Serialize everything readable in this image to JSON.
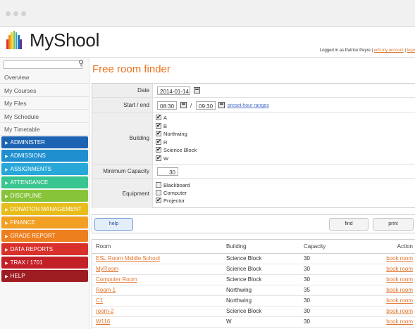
{
  "app": {
    "name": "MyShool",
    "login_prefix": "Logged in as Patrice Peyre |",
    "edit_account": "edit my account",
    "separator": "|",
    "logout": "logo"
  },
  "colors": {
    "accent": "#e8731f",
    "logo_bars": [
      "#e3342f",
      "#f28c28",
      "#f5d019",
      "#7cc242",
      "#2aa7c9",
      "#1e73be",
      "#6a2c91"
    ]
  },
  "sidebar": {
    "search_placeholder": "",
    "search_icon": "magnifier-icon",
    "plain_items": [
      "Overview",
      "My Courses",
      "My Files",
      "My Schedule",
      "My Timetable"
    ],
    "color_items": [
      {
        "label": "ADMINISTER",
        "color": "#1c64b3"
      },
      {
        "label": "ADMISSIONS",
        "color": "#1f8fd0"
      },
      {
        "label": "ASSIGNMENTS",
        "color": "#27a8d9"
      },
      {
        "label": "ATTENDANCE",
        "color": "#39c58f"
      },
      {
        "label": "DISCIPLINE",
        "color": "#88c43a"
      },
      {
        "label": "DONATION MANAGEMENT",
        "color": "#e8bd1b"
      },
      {
        "label": "FINANCE",
        "color": "#f1a023"
      },
      {
        "label": "GRADE REPORT",
        "color": "#ee7f1f"
      },
      {
        "label": "DATA REPORTS",
        "color": "#d9302b"
      },
      {
        "label": "TRAX / 1701",
        "color": "#c22026"
      },
      {
        "label": "HELP",
        "color": "#9e1d22"
      }
    ]
  },
  "main": {
    "title": "Free room finder",
    "form": {
      "date_label": "Date",
      "date_value": "2014-01-14",
      "start_end_label": "Start / end",
      "start_value": "08:30",
      "end_separator": "/",
      "end_value": "09:30",
      "preset_link": "preset hour ranges",
      "building_label": "Building",
      "buildings": [
        {
          "label": "A",
          "checked": true
        },
        {
          "label": "B",
          "checked": true
        },
        {
          "label": "Northwing",
          "checked": true
        },
        {
          "label": "R",
          "checked": true
        },
        {
          "label": "Science Block",
          "checked": true
        },
        {
          "label": "W",
          "checked": true
        }
      ],
      "capacity_label": "Minimum Capacity",
      "capacity_value": "30",
      "equipment_label": "Equipment",
      "equipment": [
        {
          "label": "Blackboard",
          "checked": false
        },
        {
          "label": "Computer",
          "checked": false
        },
        {
          "label": "Projector",
          "checked": true
        }
      ]
    },
    "buttons": {
      "help": "help",
      "find": "find",
      "print": "print"
    },
    "table": {
      "headers": [
        "Room",
        "Building",
        "Capacity",
        "Action"
      ],
      "rows": [
        {
          "room": "ESL Room Middle School",
          "building": "Science Block",
          "capacity": "30",
          "action": "book room"
        },
        {
          "room": "MyRoom",
          "building": "Science Block",
          "capacity": "30",
          "action": "book room"
        },
        {
          "room": "Computer Room",
          "building": "Science Block",
          "capacity": "30",
          "action": "book room"
        },
        {
          "room": "Room 1",
          "building": "Northwing",
          "capacity": "35",
          "action": "book room"
        },
        {
          "room": "C1",
          "building": "Northwing",
          "capacity": "30",
          "action": "book room"
        },
        {
          "room": "room-2",
          "building": "Science Block",
          "capacity": "30",
          "action": "book room"
        },
        {
          "room": "W116",
          "building": "W",
          "capacity": "30",
          "action": "book room"
        }
      ]
    }
  }
}
